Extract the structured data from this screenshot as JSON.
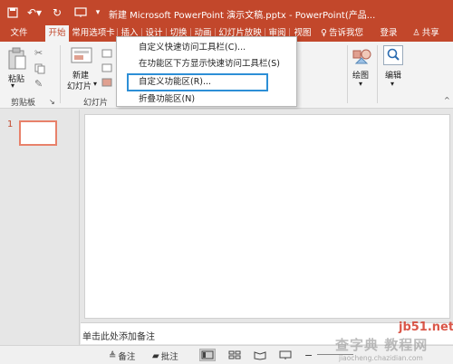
{
  "titlebar": {
    "title": "新建 Microsoft PowerPoint 演示文稿.pptx - PowerPoint(产品...",
    "color": "#c2472b"
  },
  "tabs": {
    "items": [
      {
        "label": "文件"
      },
      {
        "label": "开始"
      },
      {
        "label": "常用选项卡"
      },
      {
        "label": "插入"
      },
      {
        "label": "设计"
      },
      {
        "label": "切换"
      },
      {
        "label": "动画"
      },
      {
        "label": "幻灯片放映"
      },
      {
        "label": "审阅"
      },
      {
        "label": "视图"
      }
    ],
    "tellme": "告诉我您",
    "login": "登录",
    "share": "共享"
  },
  "ribbon": {
    "paste": "粘贴",
    "clipboard": "剪贴板",
    "new_slide_1": "新建",
    "new_slide_2": "幻灯片",
    "slides_group": "幻灯片",
    "drawing": "绘图",
    "editing": "编辑"
  },
  "menu": {
    "items": [
      {
        "label": "自定义快速访问工具栏(C)..."
      },
      {
        "label": "在功能区下方显示快速访问工具栏(S)"
      },
      {
        "label": "自定义功能区(R)..."
      },
      {
        "label": "折叠功能区(N)"
      }
    ]
  },
  "slides_pane": {
    "slide_number": "1"
  },
  "notes": {
    "placeholder": "单击此处添加备注"
  },
  "statusbar": {
    "notes": "备注",
    "comments": "批注"
  },
  "watermark": {
    "site": "jb51.net",
    "brand": "查字典 教程网",
    "url": "jiaocheng.chazidian.com"
  }
}
